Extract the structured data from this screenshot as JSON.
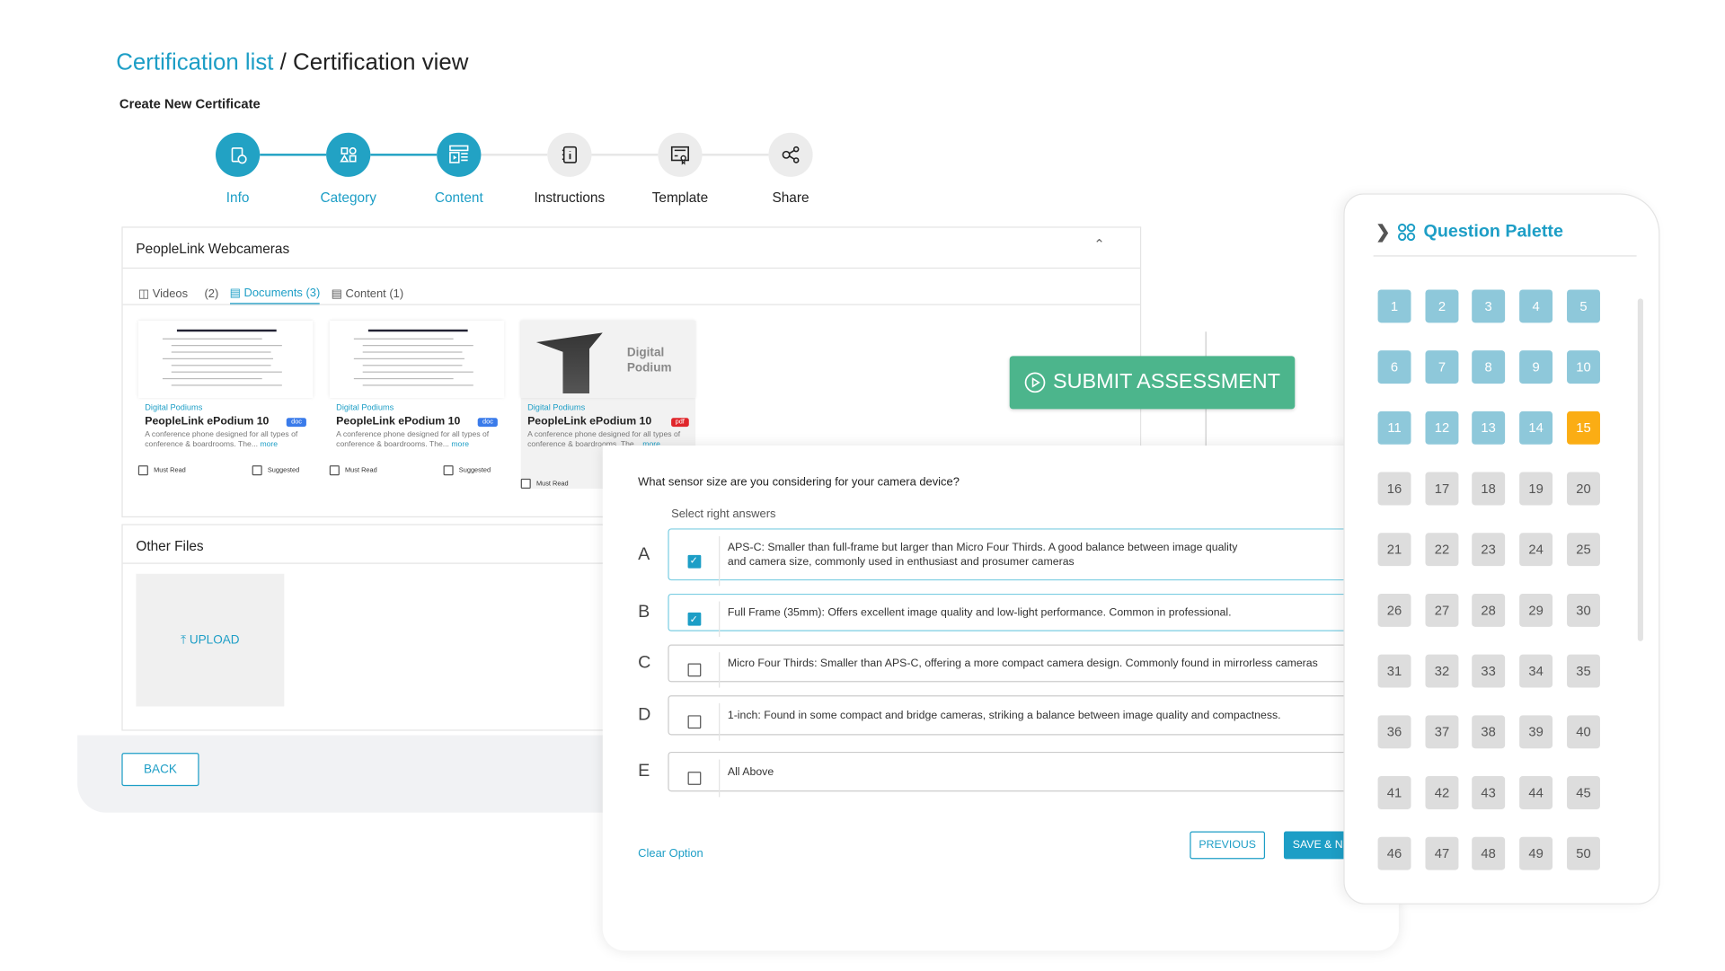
{
  "breadcrumb": {
    "link": "Certification list",
    "separator": " / ",
    "current": "Certification view"
  },
  "subtitle": "Create New Certificate",
  "steps": [
    {
      "label": "Info",
      "icon": "clipboard-info-icon",
      "done": true
    },
    {
      "label": "Category",
      "icon": "shapes-icon",
      "done": true
    },
    {
      "label": "Content",
      "icon": "content-layout-icon",
      "done": true
    },
    {
      "label": "Instructions",
      "icon": "notebook-info-icon",
      "done": false
    },
    {
      "label": "Template",
      "icon": "certificate-icon",
      "done": false
    },
    {
      "label": "Share",
      "icon": "share-icon",
      "done": false
    }
  ],
  "content_card": {
    "title": "PeopleLink Webcameras",
    "tabs": [
      {
        "label": "Videos",
        "count": "(2)"
      },
      {
        "label": "Documents (3)",
        "active": true
      },
      {
        "label": "Content (1)"
      }
    ],
    "docs": [
      {
        "category": "Digital Podiums",
        "name": "PeopleLink ePodium 10",
        "type": "doc",
        "desc": "A conference phone designed for all types of conference & boardrooms. The...",
        "more": "more",
        "must_read": "Must Read",
        "suggested": "Suggested"
      },
      {
        "category": "Digital Podiums",
        "name": "PeopleLink ePodium 10",
        "type": "doc",
        "desc": "A conference phone designed for all types of conference & boardrooms. The...",
        "more": "more",
        "must_read": "Must Read",
        "suggested": "Suggested"
      },
      {
        "category": "Digital Podiums",
        "name": "PeopleLink ePodium 10",
        "type": "pdf",
        "desc": "A conference phone designed for all types of conference & boardrooms. The...",
        "more": "more",
        "must_read": "Must Read",
        "thumb_text": "Digital Podium"
      }
    ]
  },
  "other_files": {
    "title": "Other Files",
    "upload": "UPLOAD"
  },
  "back": "BACK",
  "submit": "SUBMIT ASSESSMENT",
  "question": {
    "text": "What sensor size are you considering for your camera device?",
    "instruction": "Select right answers",
    "options": [
      {
        "letter": "A",
        "checked": true,
        "text": "APS-C: Smaller than full-frame but larger than Micro Four Thirds. A good balance between image quality\nand camera size, commonly used in enthusiast and prosumer cameras"
      },
      {
        "letter": "B",
        "checked": true,
        "text": "Full Frame (35mm): Offers excellent image quality and low-light performance. Common in professional."
      },
      {
        "letter": "C",
        "checked": false,
        "text": "Micro Four Thirds: Smaller than APS-C, offering a more compact camera design. Commonly found in mirrorless cameras"
      },
      {
        "letter": "D",
        "checked": false,
        "text": "1-inch: Found in some compact and bridge cameras, striking a balance between image quality and compactness."
      },
      {
        "letter": "E",
        "checked": false,
        "text": "All Above"
      }
    ],
    "clear": "Clear Option",
    "previous": "PREVIOUS",
    "save": "SAVE & NEXT"
  },
  "palette": {
    "title": "Question Palette",
    "answered": [
      1,
      2,
      3,
      4,
      5,
      6,
      7,
      8,
      9,
      10,
      11,
      12,
      13,
      14
    ],
    "current": 15,
    "total": 50,
    "colors": {
      "answered": "#8ec8da",
      "current": "#fbad14",
      "unanswered": "#dddddd"
    }
  }
}
